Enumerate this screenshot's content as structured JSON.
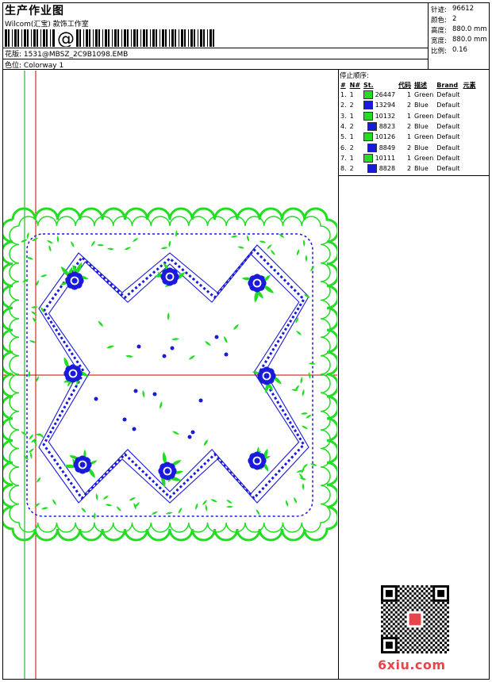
{
  "header": {
    "title": "生产作业图",
    "company": "Wilcom(汇宝) 款饰工作室",
    "barcode_symbol": "@",
    "design_label": "花版:",
    "design_name": "1531@MBSZ_2C9B1098.EMB",
    "colorway_label": "色位:",
    "colorway_name": "Colorway 1"
  },
  "stats": {
    "stitches_label": "针迹:",
    "stitches": "96612",
    "colors_label": "颜色:",
    "colors": "2",
    "height_label": "高度:",
    "height": "880.0 mm",
    "width_label": "宽度:",
    "width": "880.0 mm",
    "scale_label": "比例:",
    "scale": "0.16"
  },
  "sequence": {
    "title": "停止顺序:",
    "headers": [
      "#",
      "N#",
      "St.",
      "代码",
      "描述",
      "Brand",
      "元素"
    ],
    "rows": [
      {
        "n": "1.",
        "needle": "1",
        "color": "#22dd22",
        "st": "26447",
        "code": "1",
        "desc": "Green",
        "brand": "Default"
      },
      {
        "n": "2.",
        "needle": "2",
        "color": "#1a1add",
        "st": "13294",
        "code": "2",
        "desc": "Blue",
        "brand": "Default"
      },
      {
        "n": "3.",
        "needle": "1",
        "color": "#22dd22",
        "st": "10132",
        "code": "1",
        "desc": "Green",
        "brand": "Default"
      },
      {
        "n": "4.",
        "needle": "2",
        "color": "#1a1add",
        "st": "8823",
        "code": "2",
        "desc": "Blue",
        "brand": "Default"
      },
      {
        "n": "5.",
        "needle": "1",
        "color": "#22dd22",
        "st": "10126",
        "code": "1",
        "desc": "Green",
        "brand": "Default"
      },
      {
        "n": "6.",
        "needle": "2",
        "color": "#1a1add",
        "st": "8849",
        "code": "2",
        "desc": "Blue",
        "brand": "Default"
      },
      {
        "n": "7.",
        "needle": "1",
        "color": "#22dd22",
        "st": "10111",
        "code": "1",
        "desc": "Green",
        "brand": "Default"
      },
      {
        "n": "8.",
        "needle": "2",
        "color": "#1a1add",
        "st": "8828",
        "code": "2",
        "desc": "Blue",
        "brand": "Default"
      }
    ]
  },
  "colors": {
    "green": "#22dd22",
    "blue": "#1a1add",
    "axis_red": "#cc0000",
    "axis_green": "#00aa00",
    "logo": "#e8454b"
  },
  "icons": [
    "barcode",
    "qr-code",
    "embroidery-pattern"
  ],
  "footer": {
    "logo_text": "6xiu.com"
  }
}
